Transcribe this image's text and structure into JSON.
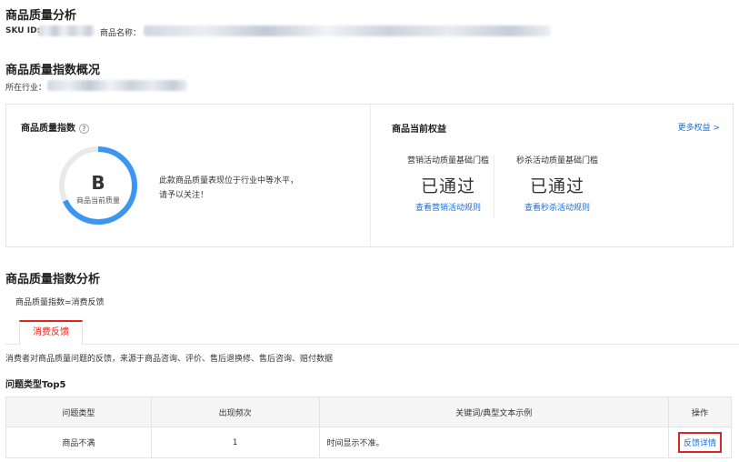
{
  "page": {
    "title": "商品质量分析",
    "sku_label": "SKU ID:",
    "product_name_label": "商品名称："
  },
  "overview": {
    "title": "商品质量指数概况",
    "industry_label": "所在行业："
  },
  "index_card": {
    "title": "商品质量指数",
    "help_icon": "?",
    "grade": "B",
    "grade_caption": "商品当前质量",
    "gauge_fill_fraction": 0.68,
    "description": "此款商品质量表现位于行业中等水平，请予以关注！",
    "accent_color": "#3a96f0"
  },
  "rights": {
    "title": "商品当前权益",
    "more_link": "更多权益 >",
    "benefits": [
      {
        "label": "营销活动质量基础门槛",
        "status": "已通过",
        "link": "查看营销活动规则"
      },
      {
        "label": "秒杀活动质量基础门槛",
        "status": "已通过",
        "link": "查看秒杀活动规则"
      }
    ]
  },
  "analysis": {
    "title": "商品质量指数分析",
    "formula": "商品质量指数=消费反馈",
    "tabs": [
      {
        "label": "消费反馈",
        "active": true
      }
    ],
    "tab_description": "消费者对商品质量问题的反馈，来源于商品咨询、评价、售后退换修、售后咨询、赔付数据",
    "top5_title": "问题类型Top5"
  },
  "table": {
    "headers": [
      "问题类型",
      "出现频次",
      "关键词/典型文本示例",
      "操作"
    ],
    "rows": [
      {
        "type": "商品不满",
        "count": "1",
        "example": "时间显示不准。",
        "action": "反馈详情"
      }
    ]
  }
}
